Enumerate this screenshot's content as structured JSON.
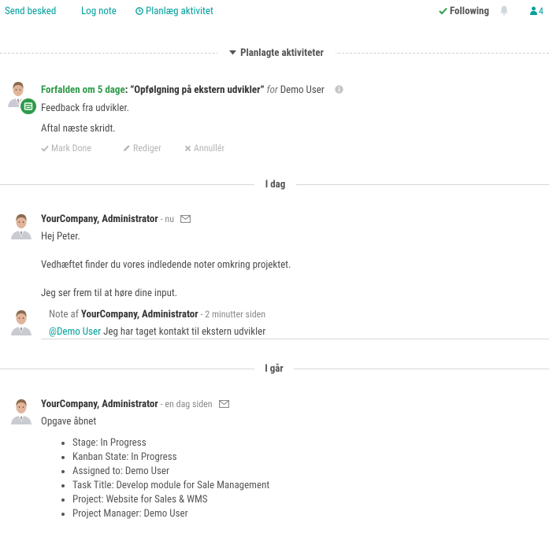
{
  "topbar": {
    "send_message": "Send besked",
    "log_note": "Log note",
    "schedule_activity": "Planlæg aktivitet",
    "following": "Following",
    "follower_count": "4"
  },
  "separators": {
    "planned": "Planlagte aktiviteter",
    "today": "I dag",
    "yesterday": "I går"
  },
  "activity": {
    "due": "Forfalden om 5 dage",
    "colon": ":",
    "title": "“Opfølgning på ekstern udvikler”",
    "for_label": "for",
    "assignee": "Demo User",
    "line1": "Feedback fra udvikler.",
    "line2": "Aftal næste skridt.",
    "mark_done": "Mark Done",
    "edit": "Rediger",
    "cancel": "Annullér"
  },
  "messages": [
    {
      "author": "YourCompany, Administrator",
      "time": "- nu",
      "lines": [
        "Hej Peter.",
        "Vedhæftet finder du vores indledende noter omkring projektet.",
        "Jeg ser frem til at høre dine input."
      ]
    }
  ],
  "note": {
    "prefix": "Note af",
    "author": "YourCompany, Administrator",
    "time": "- 2 minutter siden",
    "mention": "@Demo User",
    "text": "Jeg har taget kontakt til ekstern udvikler"
  },
  "yesterday_message": {
    "author": "YourCompany, Administrator",
    "time": "- en dag siden",
    "title": "Opgave åbnet",
    "tracking": [
      "Stage: In Progress",
      "Kanban State: In Progress",
      "Assigned to: Demo User",
      "Task Title: Develop module for Sale Management",
      "Project: Website for Sales & WMS",
      "Project Manager: Demo User"
    ]
  },
  "colors": {
    "link": "#00a09d",
    "due_green": "#2e9b49",
    "muted": "#b5b5b5"
  }
}
